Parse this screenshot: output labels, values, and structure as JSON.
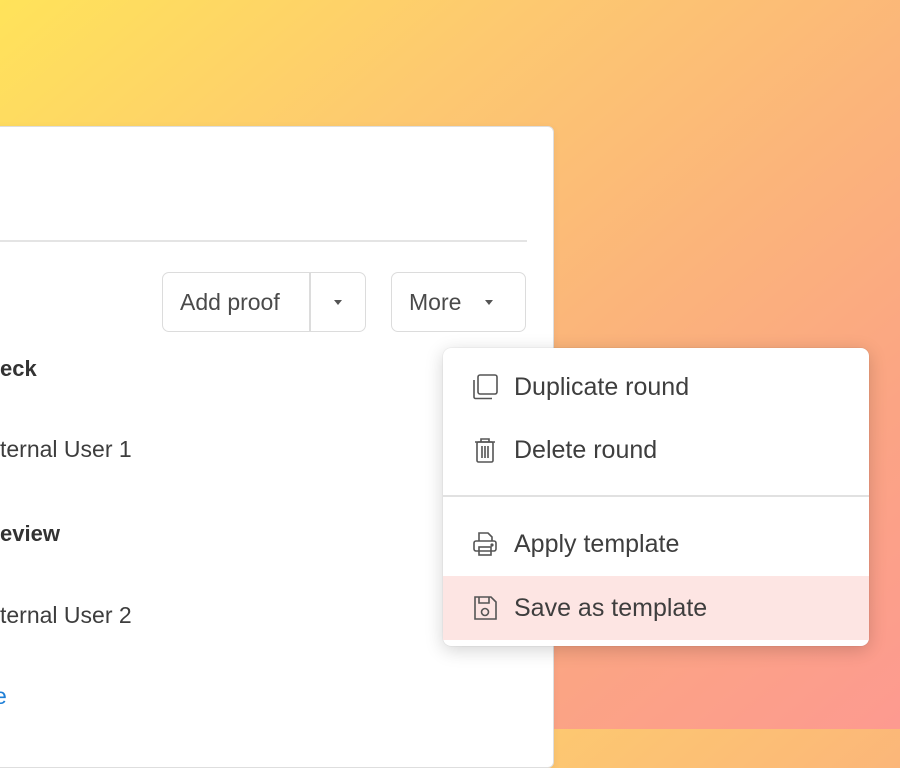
{
  "toolbar": {
    "add_proof_label": "Add proof",
    "more_label": "More"
  },
  "rows": [
    {
      "text": "eck",
      "bold": true
    },
    {
      "text": "ternal User 1",
      "bold": false
    },
    {
      "text": "eview",
      "bold": true
    },
    {
      "text": "ternal User 2",
      "bold": false
    }
  ],
  "footer_link": "e",
  "menu": {
    "items": [
      {
        "label": "Duplicate round",
        "icon": "duplicate-icon"
      },
      {
        "label": "Delete round",
        "icon": "trash-icon"
      },
      {
        "label": "Apply template",
        "icon": "printer-icon"
      },
      {
        "label": "Save as template",
        "icon": "save-icon",
        "highlighted": true
      }
    ]
  },
  "colors": {
    "highlight": "#fde5e3",
    "link": "#1f7fd6"
  }
}
